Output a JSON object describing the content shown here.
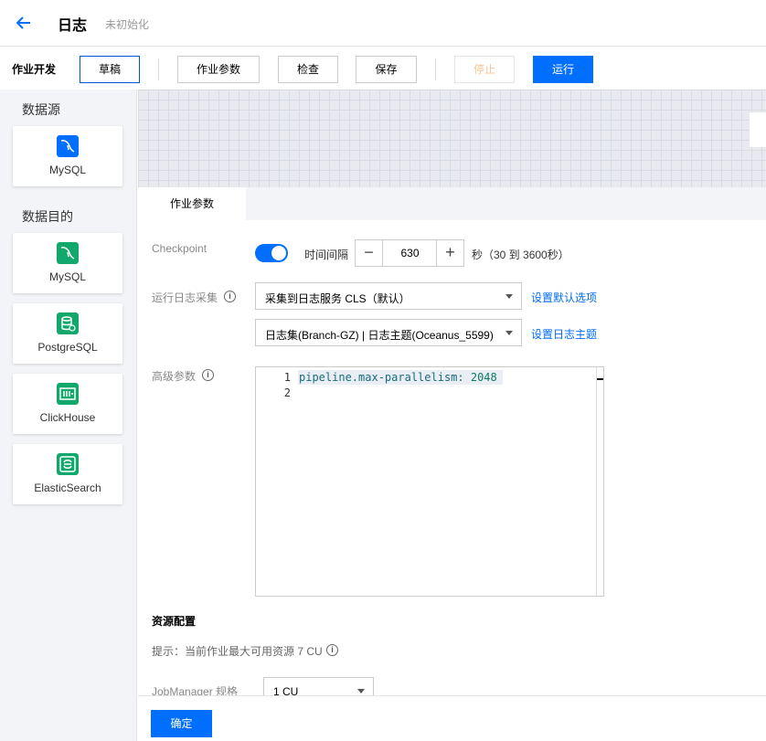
{
  "header": {
    "title": "日志",
    "status": "未初始化"
  },
  "toolbar": {
    "title": "作业开发",
    "draft": "草稿",
    "params": "作业参数",
    "check": "检查",
    "save": "保存",
    "stop": "停止",
    "run": "运行"
  },
  "sidebar": {
    "source_title": "数据源",
    "sources": [
      {
        "label": "MySQL",
        "icon": "mysql-icon",
        "color": "#006eff"
      }
    ],
    "target_title": "数据目的",
    "targets": [
      {
        "label": "MySQL",
        "icon": "mysql-icon",
        "color": "#12a86b"
      },
      {
        "label": "PostgreSQL",
        "icon": "postgresql-icon",
        "color": "#12a86b"
      },
      {
        "label": "ClickHouse",
        "icon": "clickhouse-icon",
        "color": "#12a86b"
      },
      {
        "label": "ElasticSearch",
        "icon": "elasticsearch-icon",
        "color": "#12a86b"
      }
    ]
  },
  "panel": {
    "tab": "作业参数",
    "checkpoint_label": "Checkpoint",
    "checkpoint_enabled": true,
    "interval_label": "时间间隔",
    "interval_value": "630",
    "interval_unit": "秒（30 到 3600秒）",
    "log_label": "运行日志采集",
    "log_select": "采集到日志服务 CLS（默认）",
    "log_link": "设置默认选项",
    "logset_select": "日志集(Branch-GZ) | 日志主题(Oceanus_5599)",
    "logset_link": "设置日志主题",
    "advanced_label": "高级参数",
    "editor": {
      "line1_no": "1",
      "line2_no": "2",
      "key": "pipeline.max-parallelism",
      "sep": ": ",
      "value": "2048"
    },
    "resource_heading": "资源配置",
    "resource_hint": "提示：当前作业最大可用资源 7 CU",
    "jobmanager_label": "JobManager 规格",
    "jobmanager_value": "1 CU"
  },
  "footer": {
    "confirm": "确定"
  },
  "colors": {
    "primary": "#006eff",
    "success": "#12a86b"
  }
}
